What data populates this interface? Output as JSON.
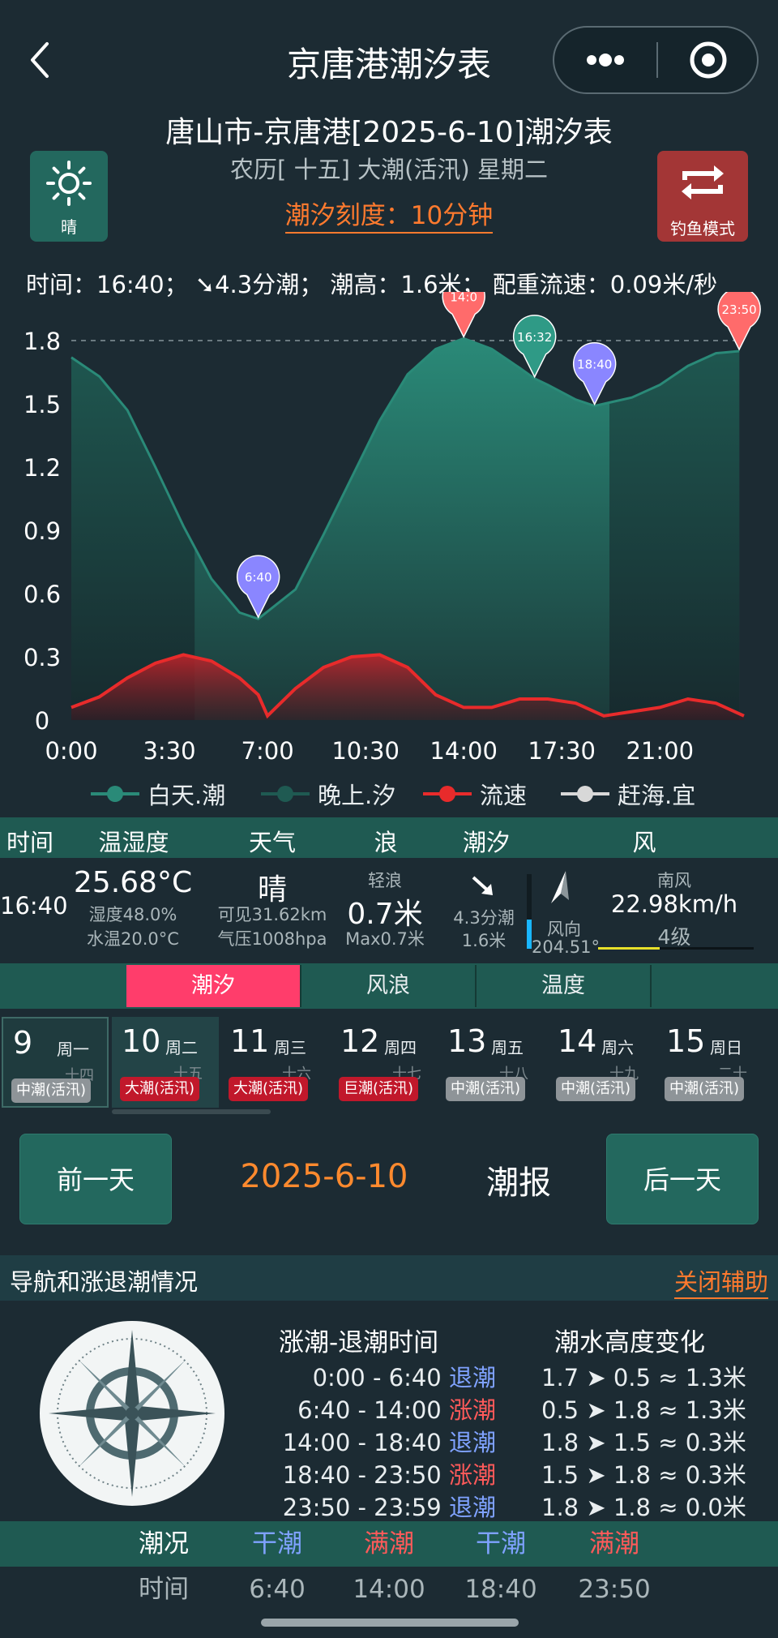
{
  "header": {
    "title": "京唐港潮汐表",
    "subtitle": "唐山市-京唐港[2025-6-10]潮汐表",
    "lunar": "农历[ 十五] 大潮(活汛) 星期二",
    "scale_link": "潮汐刻度：10分钟",
    "weather_label": "晴",
    "fishing_label": "钓鱼模式",
    "back_icon": "chevron-left-icon",
    "more_icon": "more-dots-icon",
    "close_icon": "target-icon"
  },
  "status_line": "时间：16:40；  ➘4.3分潮；  潮高：1.6米；  配重流速：0.09米/秒",
  "chart_data": {
    "type": "area",
    "x_ticks": [
      "0:00",
      "3:30",
      "7:00",
      "10:30",
      "14:00",
      "17:30",
      "21:00"
    ],
    "x_tick_hours": [
      0,
      3.5,
      7,
      10.5,
      14,
      17.5,
      21
    ],
    "xlim": [
      0,
      24
    ],
    "y_ticks": [
      "1.8",
      "1.5",
      "1.2",
      "0.9",
      "0.6",
      "0.3",
      "0"
    ],
    "ylim": [
      0,
      1.8
    ],
    "grid_y": [
      1.8
    ],
    "tide": {
      "x": [
        0,
        1,
        2,
        3,
        4,
        5,
        6,
        6.67,
        8,
        9,
        10,
        11,
        12,
        13,
        14,
        15,
        16,
        16.53,
        17,
        18,
        18.67,
        19,
        20,
        21,
        22,
        23,
        23.83
      ],
      "y": [
        1.72,
        1.63,
        1.47,
        1.2,
        0.92,
        0.67,
        0.51,
        0.48,
        0.62,
        0.88,
        1.15,
        1.42,
        1.64,
        1.76,
        1.81,
        1.76,
        1.67,
        1.62,
        1.59,
        1.52,
        1.49,
        1.5,
        1.53,
        1.59,
        1.68,
        1.74,
        1.75
      ]
    },
    "flow": {
      "x": [
        0,
        1,
        2,
        3,
        4,
        5,
        6,
        6.67,
        7,
        8,
        9,
        10,
        11,
        12,
        13,
        14,
        15,
        16,
        17,
        18,
        19,
        20,
        21,
        22,
        23,
        24
      ],
      "y": [
        0.06,
        0.11,
        0.2,
        0.27,
        0.31,
        0.28,
        0.2,
        0.12,
        0.02,
        0.15,
        0.25,
        0.3,
        0.31,
        0.25,
        0.12,
        0.06,
        0.06,
        0.1,
        0.1,
        0.08,
        0.02,
        0.04,
        0.06,
        0.1,
        0.08,
        0.02
      ]
    },
    "night_before_hour": 4.4,
    "night_after_hour": 19.2,
    "markers": [
      {
        "label": "6:40",
        "hour": 6.67,
        "value": 0.48,
        "color": "#8a86ff"
      },
      {
        "label": "14:0",
        "hour": 14.0,
        "value": 1.81,
        "color": "#ff6b6b"
      },
      {
        "label": "16:32",
        "hour": 16.53,
        "value": 1.62,
        "color": "#2f9a86"
      },
      {
        "label": "18:40",
        "hour": 18.67,
        "value": 1.49,
        "color": "#8a86ff"
      },
      {
        "label": "23:50",
        "hour": 23.83,
        "value": 1.75,
        "color": "#ff6b6b"
      }
    ],
    "legend": [
      "白天.潮",
      "晚上.汐",
      "流速",
      "赶海.宜"
    ],
    "colors": {
      "day_tide": "#2a8a78",
      "night_tide": "#1f5a52",
      "flow": "#e82b2b",
      "sea": "#d8d8d8"
    }
  },
  "info_table": {
    "headers": [
      "时间",
      "温湿度",
      "天气",
      "浪",
      "潮汐",
      "风"
    ],
    "time": "16:40",
    "temp": "25.68°C",
    "humidity": "湿度48.0%",
    "water_temp": "水温20.0°C",
    "weather": "晴",
    "visibility": "可见31.62km",
    "pressure": "气压1008hpa",
    "wave_label": "轻浪",
    "wave_height": "0.7米",
    "wave_max": "Max0.7米",
    "tide_phase": "4.3分潮",
    "tide_height": "1.6米",
    "wind_dir_label": "风向",
    "wind_deg": "204.51°",
    "wind_name": "南风",
    "wind_speed": "22.98km/h",
    "wind_level": "4级"
  },
  "tabs": [
    "潮汐",
    "风浪",
    "温度"
  ],
  "days": [
    {
      "day": "9",
      "week": "周一",
      "lunar": "十四",
      "badge": "中潮(活汛)",
      "red": false
    },
    {
      "day": "10",
      "week": "周二",
      "lunar": "十五",
      "badge": "大潮(活汛)",
      "red": true
    },
    {
      "day": "11",
      "week": "周三",
      "lunar": "十六",
      "badge": "大潮(活汛)",
      "red": true
    },
    {
      "day": "12",
      "week": "周四",
      "lunar": "十七",
      "badge": "巨潮(活汛)",
      "red": true
    },
    {
      "day": "13",
      "week": "周五",
      "lunar": "十八",
      "badge": "中潮(活汛)",
      "red": false
    },
    {
      "day": "14",
      "week": "周六",
      "lunar": "十九",
      "badge": "中潮(活汛)",
      "red": false
    },
    {
      "day": "15",
      "week": "周日",
      "lunar": "二十",
      "badge": "中潮(活汛)",
      "red": false
    }
  ],
  "nav": {
    "prev": "前一天",
    "date": "2025-6-10",
    "report": "潮报",
    "next": "后一天"
  },
  "guide": {
    "title": "导航和涨退潮情况",
    "toggle": "关闭辅助",
    "col1": "涨潮-退潮时间",
    "col2": "潮水高度变化",
    "rows": [
      {
        "range": "0:00 - 6:40",
        "type": "退潮",
        "change": "1.7 ➤ 0.5 ≈ 1.3米"
      },
      {
        "range": "6:40 - 14:00",
        "type": "涨潮",
        "change": "0.5 ➤ 1.8 ≈ 1.3米"
      },
      {
        "range": "14:00 - 18:40",
        "type": "退潮",
        "change": "1.8 ➤ 1.5 ≈ 0.3米"
      },
      {
        "range": "18:40 - 23:50",
        "type": "涨潮",
        "change": "1.5 ➤ 1.8 ≈ 0.3米"
      },
      {
        "range": "23:50 - 23:59",
        "type": "退潮",
        "change": "1.8 ➤ 1.8 ≈ 0.0米"
      }
    ]
  },
  "summary": {
    "head": [
      "潮况",
      "干潮",
      "满潮",
      "干潮",
      "满潮"
    ],
    "time": [
      "时间",
      "6:40",
      "14:00",
      "18:40",
      "23:50"
    ]
  }
}
